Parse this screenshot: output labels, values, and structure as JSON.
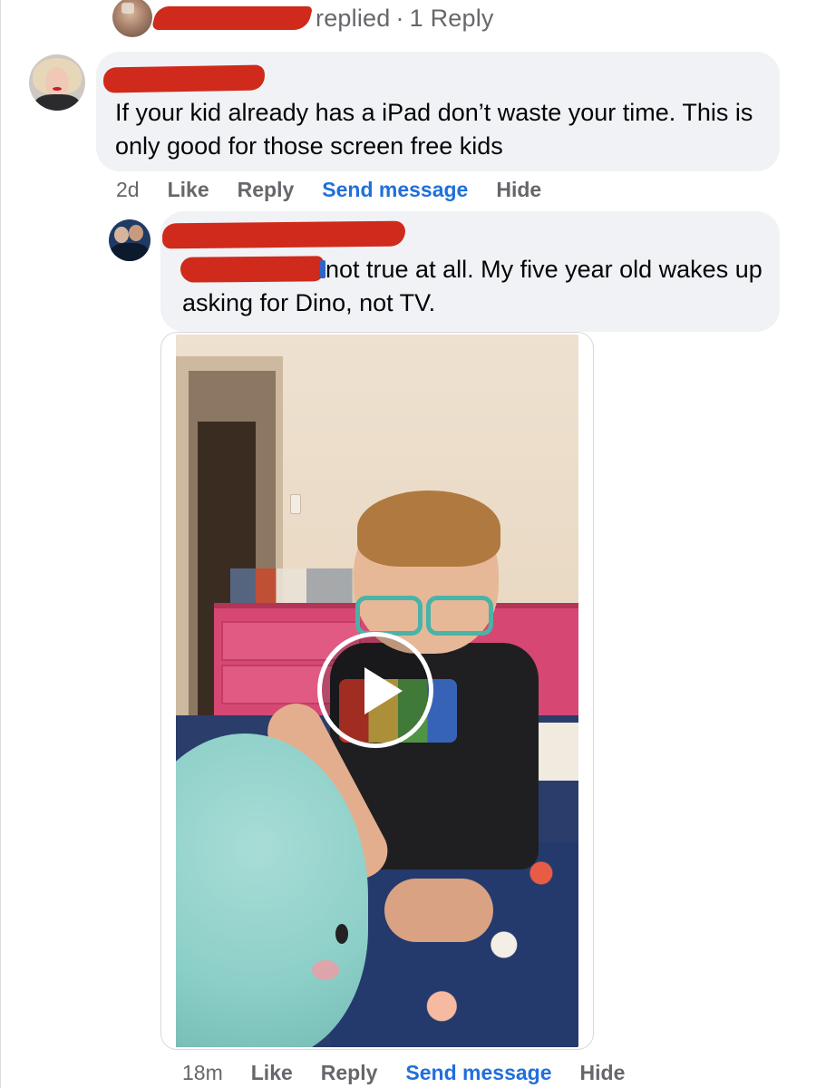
{
  "thread": {
    "replied_label": "replied",
    "separator": "·",
    "reply_count": "1 Reply"
  },
  "comment_1": {
    "text": "If your kid already has a iPad don’t waste your time. This is only good for those screen free kids",
    "time": "2d",
    "like_label": "Like",
    "reply_label": "Reply",
    "send_message_label": "Send message",
    "hide_label": "Hide"
  },
  "comment_2": {
    "text": "not true at all. My five year old wakes up asking for Dino, not TV.",
    "time": "18m",
    "like_label": "Like",
    "reply_label": "Reply",
    "send_message_label": "Send message",
    "hide_label": "Hide",
    "attachment": {
      "type": "video",
      "play_icon": "play-icon"
    }
  },
  "colors": {
    "bubble": "#f0f2f5",
    "secondary_text": "#65676b",
    "link_blue": "#216fdb",
    "redaction": "#cf2a1b"
  }
}
